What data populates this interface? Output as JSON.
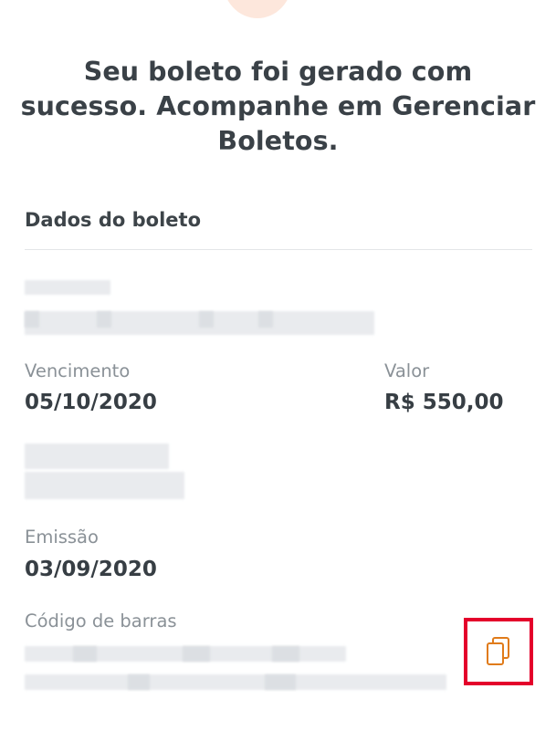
{
  "success_message": "Seu boleto foi gerado com sucesso. Acompanhe em Gerenciar Boletos.",
  "section_title": "Dados do boleto",
  "due_date": {
    "label": "Vencimento",
    "value": "05/10/2020"
  },
  "amount": {
    "label": "Valor",
    "value": "R$ 550,00"
  },
  "issue_date": {
    "label": "Emissão",
    "value": "03/09/2020"
  },
  "barcode": {
    "label": "Código de barras",
    "copy_icon": "copy-icon"
  },
  "colors": {
    "accent": "#e07b1a",
    "highlight": "#e4002b",
    "text": "#3b4248",
    "muted": "#8a9197"
  }
}
